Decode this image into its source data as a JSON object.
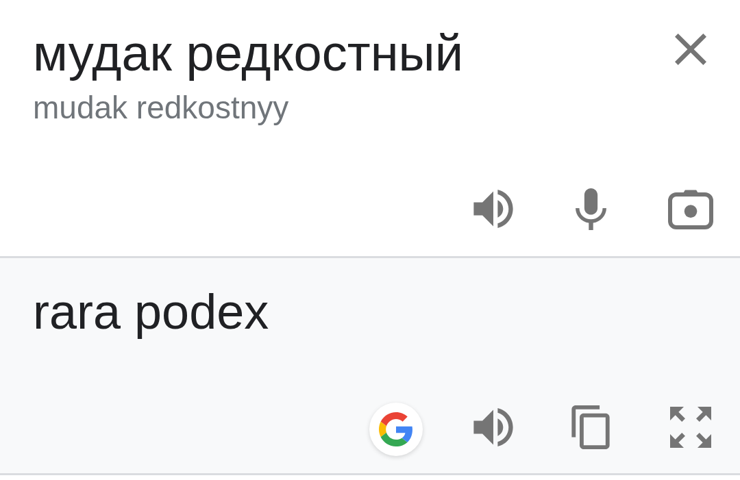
{
  "source": {
    "text": "мудак редкостный",
    "transliteration": "mudak redkostnyy"
  },
  "translation": {
    "text": "rara podex"
  }
}
